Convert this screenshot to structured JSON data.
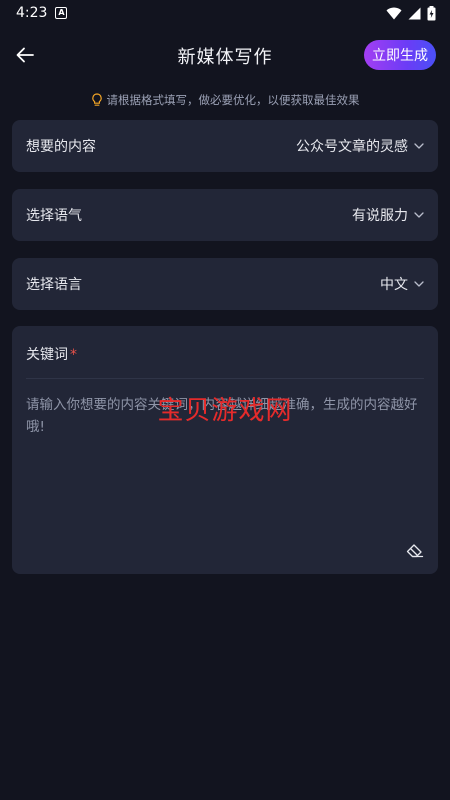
{
  "status_bar": {
    "time": "4:23",
    "badge": "A"
  },
  "header": {
    "title": "新媒体写作",
    "generate_label": "立即生成"
  },
  "hint": {
    "text": "请根据格式填写，做必要优化，以便获取最佳效果"
  },
  "fields": {
    "content": {
      "label": "想要的内容",
      "value": "公众号文章的灵感"
    },
    "tone": {
      "label": "选择语气",
      "value": "有说服力"
    },
    "language": {
      "label": "选择语言",
      "value": "中文"
    }
  },
  "keywords": {
    "label": "关键词",
    "required_mark": "*",
    "placeholder": "请输入你想要的内容关键词，内容越详细越准确，生成的内容越好哦!"
  },
  "watermark": {
    "text": "宝贝游戏网"
  },
  "colors": {
    "background": "#12141f",
    "card": "#222637",
    "accent_start": "#a33ef2",
    "accent_end": "#4a50f6",
    "required": "#e9524a",
    "hint_icon": "#f0a326",
    "watermark": "#e52b2b"
  }
}
